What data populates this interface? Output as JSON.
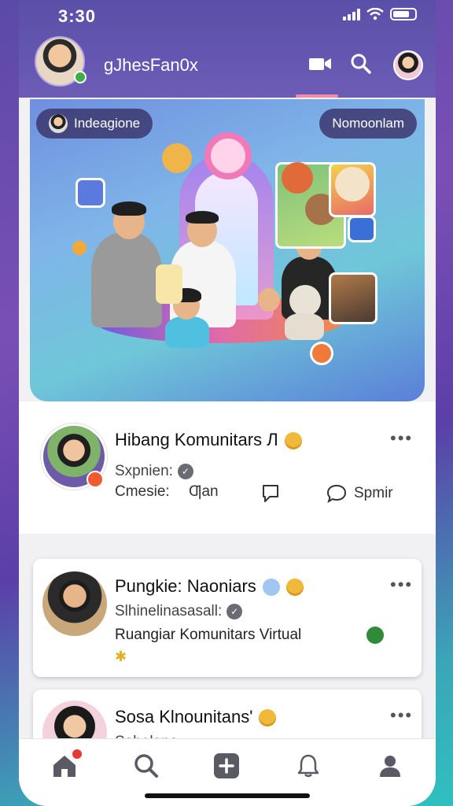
{
  "status": {
    "time": "3:30"
  },
  "header": {
    "title": "gJhesFan0x",
    "icons": [
      "video-icon",
      "search-icon",
      "profile-avatar"
    ]
  },
  "hero": {
    "chip_left": "Indeagione",
    "chip_right": "Nomoonlam"
  },
  "posts": [
    {
      "title": "Hibang Komunitars Л",
      "subtitle": "Sxpnien:",
      "actions": {
        "left": "Cmesie:",
        "mid": "Ƣan",
        "share": "Spmir"
      }
    },
    {
      "title": "Pungkie: Naoniars",
      "subtitle": "Slhinelinasasall:",
      "body": "Ruangiar Komunitars Virtual"
    },
    {
      "title": "Sosa Klnounitans'",
      "subtitle": "Sabelana"
    }
  ],
  "bottom_nav": [
    "home-icon",
    "search-icon",
    "add-icon",
    "bell-icon",
    "profile-icon"
  ],
  "colors": {
    "header_bg": "#5a4fa8",
    "accent_pink": "#f28ba6",
    "online_green": "#3fae49",
    "notification_red": "#e53935"
  }
}
